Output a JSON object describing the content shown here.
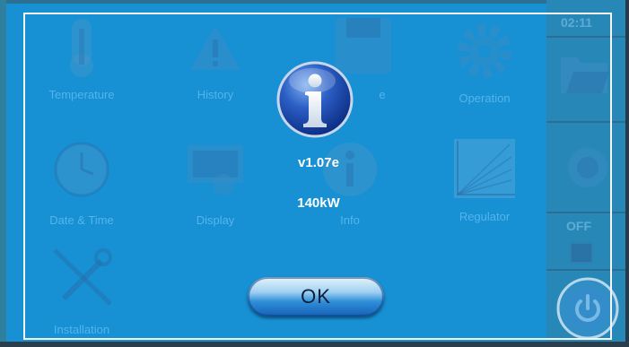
{
  "menu": {
    "items": [
      {
        "label": "Temperature",
        "icon": "thermometer-icon"
      },
      {
        "label": "History",
        "icon": "warning-icon"
      },
      {
        "label": "",
        "icon": "save-icon",
        "partial_label": "e"
      },
      {
        "label": "Operation",
        "icon": "gear-icon"
      },
      {
        "label": "Date & Time",
        "icon": "clock-icon"
      },
      {
        "label": "Display",
        "icon": "display-icon"
      },
      {
        "label": "Info",
        "icon": "info-icon"
      },
      {
        "label": "Regulator",
        "icon": "regulator-chart-icon"
      },
      {
        "label": "Installation",
        "icon": "tools-icon"
      }
    ]
  },
  "sidebar": {
    "time": "02:11",
    "status": "OFF"
  },
  "dialog": {
    "icon": "info-icon",
    "version": "v1.07e",
    "power": "140kW",
    "ok_label": "OK"
  },
  "colors": {
    "background": "#1790d4",
    "dialog_border": "#f2f6f9",
    "button_blue": "#2f8fd8"
  }
}
